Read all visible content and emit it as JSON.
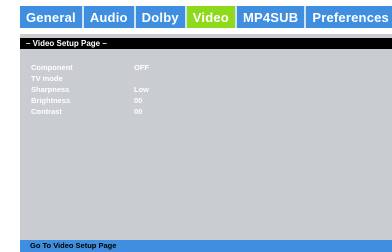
{
  "tabs": [
    {
      "label": "General",
      "active": false
    },
    {
      "label": "Audio",
      "active": false
    },
    {
      "label": "Dolby",
      "active": false
    },
    {
      "label": "Video",
      "active": true
    },
    {
      "label": "MP4SUB",
      "active": false
    },
    {
      "label": "Preferences",
      "active": false
    }
  ],
  "panel": {
    "title": "– Video Setup Page –",
    "rows": [
      {
        "label": "Component",
        "value": "OFF"
      },
      {
        "label": "TV mode",
        "value": ""
      },
      {
        "label": "Sharpness",
        "value": "Low"
      },
      {
        "label": "Brightness",
        "value": "00"
      },
      {
        "label": "Contrast",
        "value": "00"
      }
    ]
  },
  "status": {
    "text": "Go To Video Setup Page"
  },
  "colors": {
    "tab_bar": "#3f8ee0",
    "active_tab": "#8ed91c",
    "panel_bg": "#c9ccd0",
    "title_bar": "#000000"
  }
}
